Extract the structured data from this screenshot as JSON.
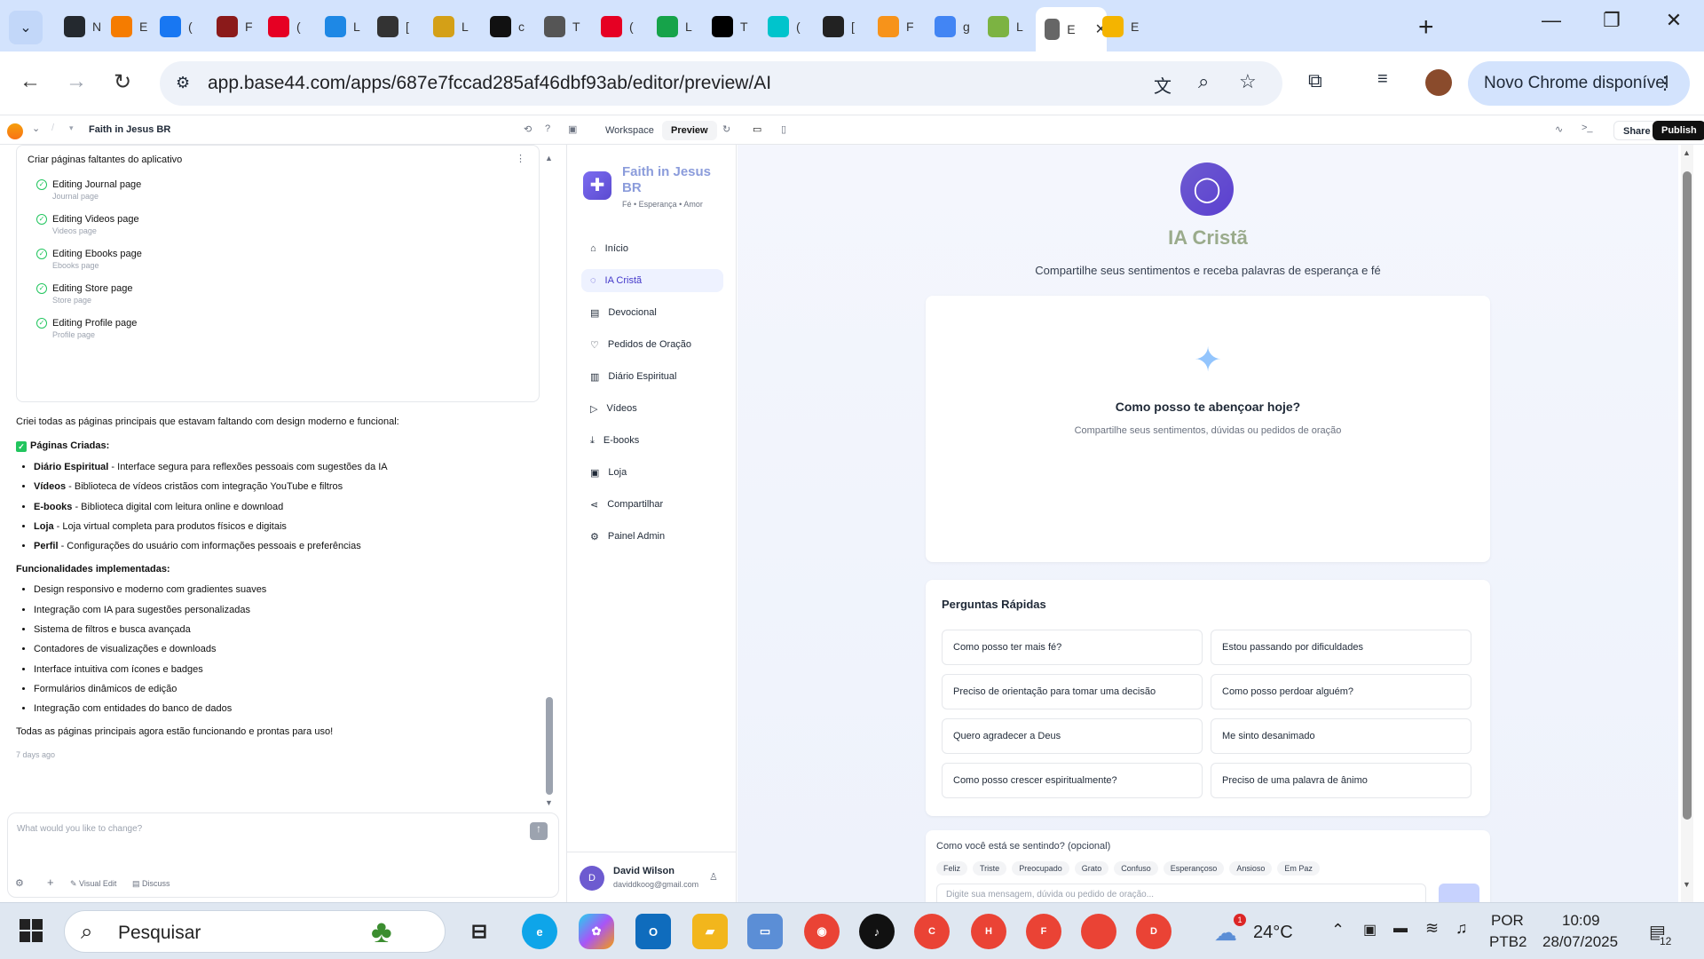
{
  "browser": {
    "tabs": [
      {
        "letter": "N",
        "icon": "github-icon",
        "color": "#24292f"
      },
      {
        "letter": "E",
        "icon": "blogger-icon",
        "color": "#f57c00"
      },
      {
        "letter": "(",
        "icon": "facebook-icon",
        "color": "#1877f2"
      },
      {
        "letter": "F",
        "icon": "book-icon",
        "color": "#8b1a1a"
      },
      {
        "letter": "(",
        "icon": "pinterest-icon",
        "color": "#e60023"
      },
      {
        "letter": "L",
        "icon": "magnifier-icon",
        "color": "#1e88e5"
      },
      {
        "letter": "[",
        "icon": "dnai-icon",
        "color": "#333333"
      },
      {
        "letter": "L",
        "icon": "food-icon",
        "color": "#d4a017"
      },
      {
        "letter": "c",
        "icon": "envelope-icon",
        "color": "#111111"
      },
      {
        "letter": "T",
        "icon": "globe-icon",
        "color": "#555555"
      },
      {
        "letter": "(",
        "icon": "pinterest-icon",
        "color": "#e60023"
      },
      {
        "letter": "L",
        "icon": "star-icon",
        "color": "#16a34a"
      },
      {
        "letter": "T",
        "icon": "tiktok-icon",
        "color": "#000000"
      },
      {
        "letter": "(",
        "icon": "canva-icon",
        "color": "#00c4cc"
      },
      {
        "letter": "[",
        "icon": "openai-icon",
        "color": "#222222"
      },
      {
        "letter": "F",
        "icon": "bitcoin-icon",
        "color": "#f7931a"
      },
      {
        "letter": "g",
        "icon": "google-icon",
        "color": "#4285f4"
      },
      {
        "letter": "L",
        "icon": "l-icon",
        "color": "#7cb342"
      },
      {
        "letter": "E",
        "icon": "page-icon",
        "color": "#666666",
        "active": true
      },
      {
        "letter": "E",
        "icon": "colorful-dots-icon",
        "color": "#f4b400"
      }
    ],
    "url": "app.base44.com/apps/687e7fccad285af46dbf93ab/editor/preview/AI",
    "new_chrome": "Novo Chrome disponível"
  },
  "appbar": {
    "project": "Faith in Jesus BR",
    "workspace": "Workspace",
    "preview": "Preview",
    "share": "Share",
    "publish": "Publish"
  },
  "chat": {
    "task_title": "Criar páginas faltantes do aplicativo",
    "tasks": [
      {
        "title": "Editing Journal page",
        "sub": "Journal page"
      },
      {
        "title": "Editing Videos page",
        "sub": "Videos page"
      },
      {
        "title": "Editing Ebooks page",
        "sub": "Ebooks page"
      },
      {
        "title": "Editing Store page",
        "sub": "Store page"
      },
      {
        "title": "Editing Profile page",
        "sub": "Profile page"
      }
    ],
    "intro": "Criei todas as páginas principais que estavam faltando com design moderno e funcional:",
    "created_heading": "Páginas Criadas:",
    "created": [
      {
        "b": "Diário Espiritual",
        "t": " - Interface segura para reflexões pessoais com sugestões da IA"
      },
      {
        "b": "Vídeos",
        "t": " - Biblioteca de vídeos cristãos com integração YouTube e filtros"
      },
      {
        "b": "E-books",
        "t": " - Biblioteca digital com leitura online e download"
      },
      {
        "b": "Loja",
        "t": " - Loja virtual completa para produtos físicos e digitais"
      },
      {
        "b": "Perfil",
        "t": " - Configurações do usuário com informações pessoais e preferências"
      }
    ],
    "features_heading": "Funcionalidades implementadas:",
    "features": [
      "Design responsivo e moderno com gradientes suaves",
      "Integração com IA para sugestões personalizadas",
      "Sistema de filtros e busca avançada",
      "Contadores de visualizações e downloads",
      "Interface intuitiva com ícones e badges",
      "Formulários dinâmicos de edição",
      "Integração com entidades do banco de dados"
    ],
    "outro": "Todas as páginas principais agora estão funcionando e prontas para uso!",
    "time": "7 days ago",
    "placeholder": "What would you like to change?",
    "visual_edit": "Visual Edit",
    "discuss": "Discuss"
  },
  "sidebar": {
    "app_name": "Faith in Jesus BR",
    "tagline": "Fé • Esperança • Amor",
    "items": [
      {
        "label": "Início",
        "icon": "home-icon"
      },
      {
        "label": "IA Cristã",
        "icon": "chat-icon",
        "active": true
      },
      {
        "label": "Devocional",
        "icon": "book-icon"
      },
      {
        "label": "Pedidos de Oração",
        "icon": "heart-icon"
      },
      {
        "label": "Diário Espiritual",
        "icon": "open-book-icon"
      },
      {
        "label": "Vídeos",
        "icon": "video-icon"
      },
      {
        "label": "E-books",
        "icon": "download-icon"
      },
      {
        "label": "Loja",
        "icon": "bag-icon"
      },
      {
        "label": "Compartilhar",
        "icon": "share-icon"
      },
      {
        "label": "Painel Admin",
        "icon": "gear-icon"
      }
    ],
    "user_initial": "D",
    "user_name": "David Wilson",
    "user_email": "daviddkoog@gmail.com"
  },
  "main": {
    "title": "IA Cristã",
    "subtitle": "Compartilhe seus sentimentos e receba palavras de esperança e fé",
    "empty_title": "Como posso te abençoar hoje?",
    "empty_sub": "Compartilhe seus sentimentos, dúvidas ou pedidos de oração",
    "quick_title": "Perguntas Rápidas",
    "quick": [
      "Como posso ter mais fé?",
      "Estou passando por dificuldades",
      "Preciso de orientação para tomar uma decisão",
      "Como posso perdoar alguém?",
      "Quero agradecer a Deus",
      "Me sinto desanimado",
      "Como posso crescer espiritualmente?",
      "Preciso de uma palavra de ânimo"
    ],
    "mood_label": "Como você está se sentindo? (opcional)",
    "moods": [
      "Feliz",
      "Triste",
      "Preocupado",
      "Grato",
      "Confuso",
      "Esperançoso",
      "Ansioso",
      "Em Paz"
    ],
    "input_placeholder": "Digite sua mensagem, dúvida ou pedido de oração..."
  },
  "taskbar": {
    "search": "Pesquisar",
    "weather_temp": "24°C",
    "weather_badge": "1",
    "lang1": "POR",
    "lang2": "PTB2",
    "time": "10:09",
    "date": "28/07/2025",
    "notif_count": "12",
    "chrome_profiles": [
      "C",
      "H",
      "F",
      "",
      "D"
    ]
  },
  "colors": {
    "accent": "#6d5bd0",
    "title_green": "#9aab8c",
    "publish_bg": "#111111",
    "tabstrip": "#d3e3fd"
  }
}
